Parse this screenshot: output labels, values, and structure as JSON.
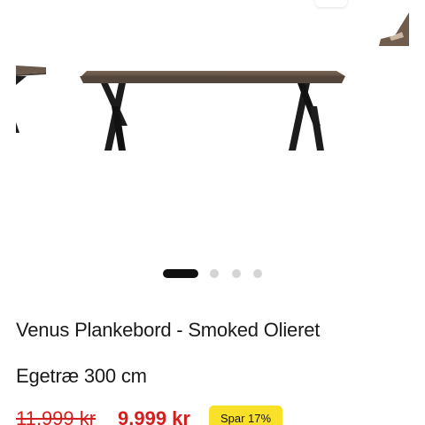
{
  "product": {
    "title": "Venus Plankebord - Smoked Olieret",
    "subtitle": "Egetræ 300 cm",
    "old_price": "11.999 kr",
    "new_price": "9.999 kr",
    "save_badge": "Spar 17%"
  },
  "gallery": {
    "image_count": 4,
    "active_index": 0,
    "main_image": "dining-table-x-legs-image"
  },
  "colors": {
    "price_red": "#d41f1f",
    "badge_yellow": "#f9e12a",
    "dot_active": "#111111",
    "dot_inactive": "#d4d4d4",
    "table_top": "#6b5a4c",
    "legs": "#1c1c1c"
  }
}
